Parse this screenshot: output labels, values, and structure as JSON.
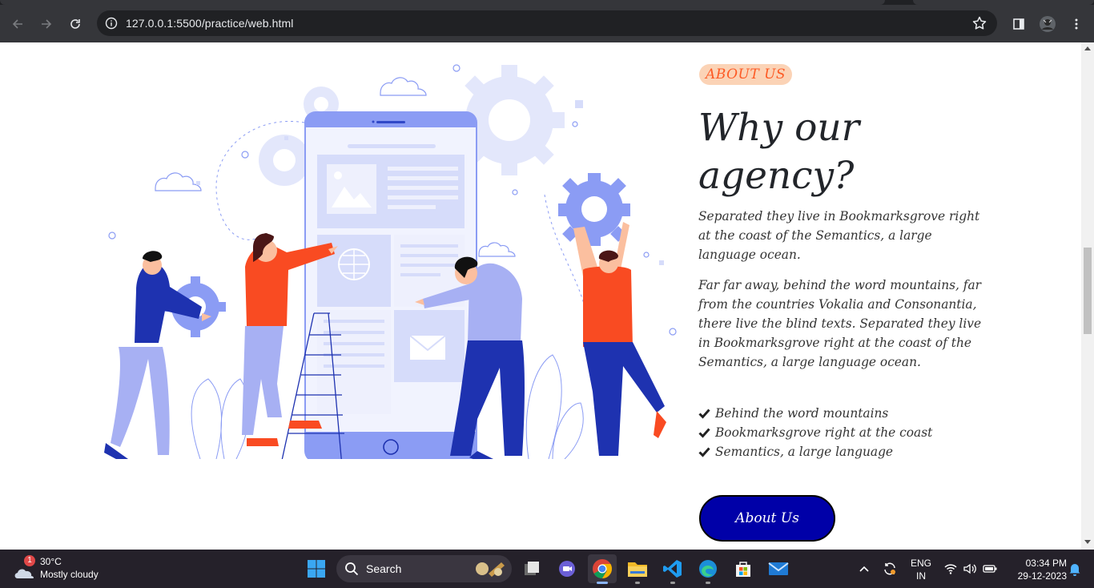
{
  "browser": {
    "url": "127.0.0.1:5500/practice/web.html"
  },
  "page": {
    "badge": "ABOUT US",
    "heading": "Why our agency?",
    "paragraph1": "Separated they live in Bookmarksgrove right at the coast of the Semantics, a large language ocean.",
    "paragraph2": "Far far away, behind the word mountains, far from the countries Vokalia and Consonantia, there live the blind texts. Separated they live in Bookmarksgrove right at the coast of the Semantics, a large language ocean.",
    "checklist": [
      "Behind the word mountains",
      "Bookmarksgrove right at the coast",
      "Semantics, a large language"
    ],
    "button_label": "About Us",
    "colors": {
      "accent": "#fd5a24",
      "badge_bg": "#fbd3b6",
      "button": "#0000a8",
      "illustration_blue": "#8b9cf4"
    }
  },
  "taskbar": {
    "weather_temp": "30°C",
    "weather_desc": "Mostly cloudy",
    "weather_badge": "1",
    "search_label": "Search",
    "language_top": "ENG",
    "language_bottom": "IN",
    "time": "03:34 PM",
    "date": "29-12-2023",
    "pinned_apps": [
      "windows-start-icon",
      "file-explorer-icon",
      "video-chat-icon",
      "chrome-icon",
      "folder-icon",
      "vscode-icon",
      "edge-icon",
      "store-icon",
      "mail-icon"
    ]
  }
}
